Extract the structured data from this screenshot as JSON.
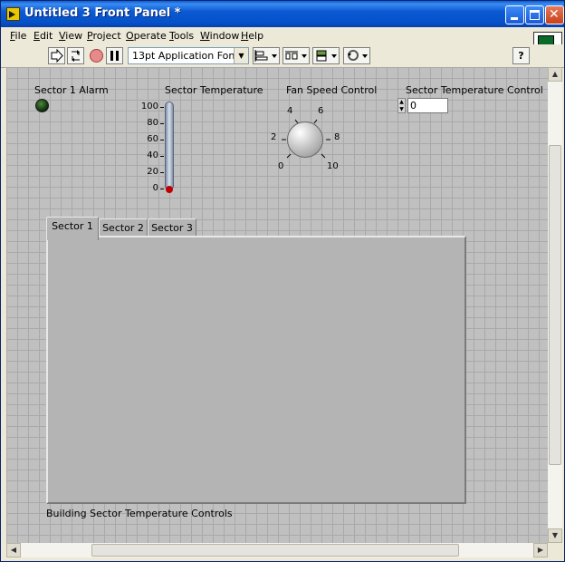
{
  "window": {
    "title": "Untitled 3 Front Panel *"
  },
  "menu": [
    "File",
    "Edit",
    "View",
    "Project",
    "Operate",
    "Tools",
    "Window",
    "Help"
  ],
  "toolbar": {
    "font": "13pt Application Font",
    "help": "?"
  },
  "vi_icon_number": "3",
  "panel": {
    "alarm_label": "Sector 1 Alarm",
    "temp_label": "Sector Temperature",
    "temp_scale": [
      "100",
      "80",
      "60",
      "40",
      "20",
      "0"
    ],
    "temp_value": 0,
    "fan_label": "Fan Speed Control",
    "fan_scale": [
      "0",
      "2",
      "4",
      "6",
      "8",
      "10"
    ],
    "temp_control_label": "Sector Temperature Control",
    "temp_control_value": "0",
    "tabs": [
      "Sector 1",
      "Sector 2",
      "Sector 3"
    ],
    "tab_caption": "Building Sector Temperature Controls"
  }
}
